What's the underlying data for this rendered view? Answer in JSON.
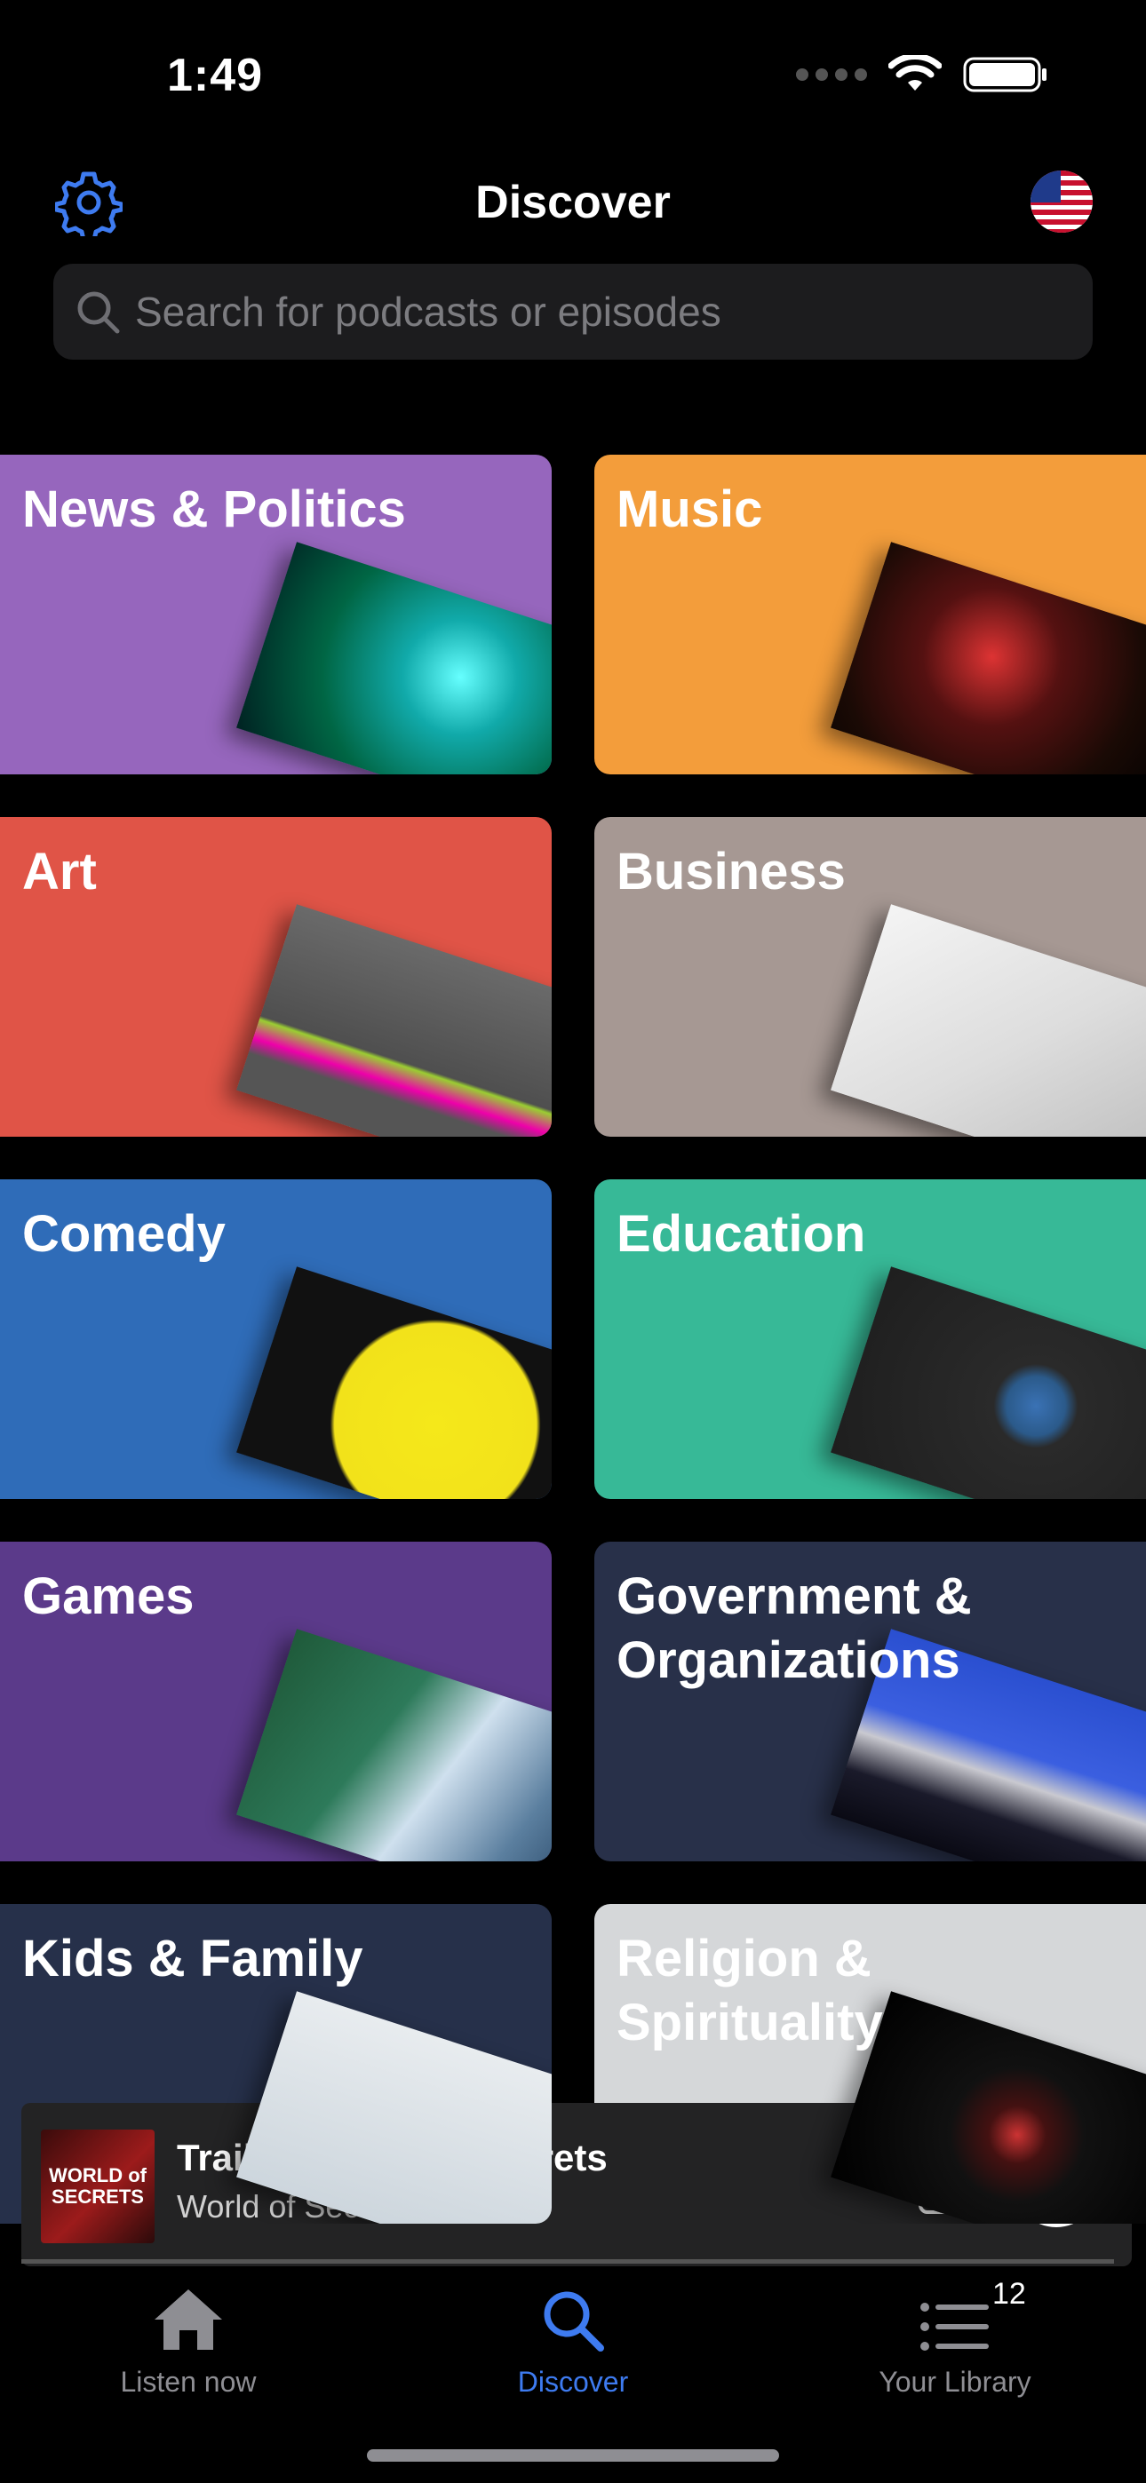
{
  "status": {
    "time": "1:49"
  },
  "header": {
    "title": "Discover"
  },
  "search": {
    "placeholder": "Search for podcasts or episodes"
  },
  "categories": [
    {
      "label": "News & Politics",
      "color": "#9666bd"
    },
    {
      "label": "Music",
      "color": "#f39d3b"
    },
    {
      "label": "Art",
      "color": "#e05447"
    },
    {
      "label": "Business",
      "color": "#a69893"
    },
    {
      "label": "Comedy",
      "color": "#2f6cb8"
    },
    {
      "label": "Education",
      "color": "#37b997"
    },
    {
      "label": "Games",
      "color": "#5b3a8a"
    },
    {
      "label": "Government & Organizations",
      "color": "#283049"
    },
    {
      "label": "Kids & Family",
      "color": "#26304a"
    },
    {
      "label": "Religion & Spirituality",
      "color": "#d5d7d9"
    }
  ],
  "player": {
    "title": "Trailer: World of Secrets",
    "subtitle": "World of Secrets",
    "cover_text": "WORLD of SECRETS"
  },
  "tabs": [
    {
      "label": "Listen now",
      "active": false
    },
    {
      "label": "Discover",
      "active": true
    },
    {
      "label": "Your Library",
      "active": false,
      "badge": "12"
    }
  ],
  "colors": {
    "accent": "#3e7bf0",
    "inactive": "#8e8e93",
    "search_bg": "#1c1c1e"
  }
}
